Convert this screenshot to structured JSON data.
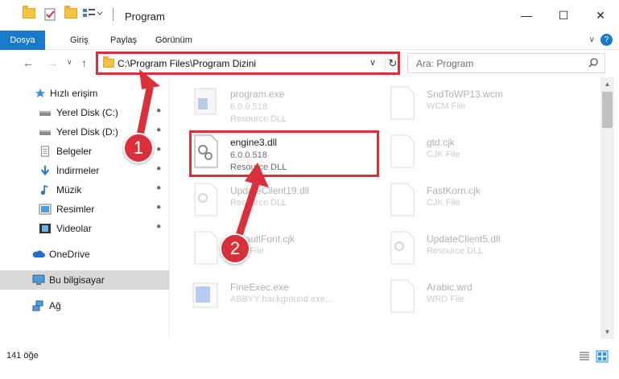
{
  "window": {
    "title": "Program",
    "minimize_icon": "minimize-icon",
    "maximize_icon": "maximize-icon",
    "close_icon": "close-icon"
  },
  "ribbon": {
    "tabs": [
      "Dosya",
      "Giriş",
      "Paylaş",
      "Görünüm"
    ],
    "help": "?"
  },
  "address": {
    "path": "C:\\Program Files\\Program Dizini",
    "search_placeholder": "Ara: Program"
  },
  "sidebar": {
    "items": [
      {
        "label": "Hızlı erişim",
        "icon": "star-icon",
        "pinned": false
      },
      {
        "label": "Yerel Disk (C:)",
        "icon": "disk-icon",
        "pinned": true
      },
      {
        "label": "Yerel Disk (D:)",
        "icon": "disk-icon",
        "pinned": true
      },
      {
        "label": "Belgeler",
        "icon": "documents-icon",
        "pinned": true
      },
      {
        "label": "İndirmeler",
        "icon": "download-icon",
        "pinned": true
      },
      {
        "label": "Müzik",
        "icon": "music-icon",
        "pinned": true
      },
      {
        "label": "Resimler",
        "icon": "pictures-icon",
        "pinned": true
      },
      {
        "label": "Videolar",
        "icon": "video-icon",
        "pinned": true
      },
      {
        "label": "OneDrive",
        "icon": "cloud-icon",
        "pinned": false
      },
      {
        "label": "Bu bilgisayar",
        "icon": "computer-icon",
        "pinned": false,
        "selected": true
      },
      {
        "label": "Ağ",
        "icon": "network-icon",
        "pinned": false
      }
    ]
  },
  "files": [
    {
      "name": "program.exe",
      "version": "6.0.0.518",
      "desc": "Resource DLL",
      "faded": true
    },
    {
      "name": "SndToWP13.wcm",
      "version": "",
      "desc": "WCM File",
      "faded": true
    },
    {
      "name": "engine3.dll",
      "version": "6.0.0.518",
      "desc": "Resource DLL",
      "faded": false
    },
    {
      "name": "gtd.cjk",
      "version": "",
      "desc": "CJK File",
      "faded": true
    },
    {
      "name": "UpdateClient19.dll",
      "version": "",
      "desc": "Resource DLL",
      "faded": true
    },
    {
      "name": "FastKorn.cjk",
      "version": "",
      "desc": "CJK File",
      "faded": true
    },
    {
      "name": "DefaultFont.cjk",
      "version": "",
      "desc": "CJK File",
      "faded": true
    },
    {
      "name": "UpdateClient5.dll",
      "version": "",
      "desc": "Resource DLL",
      "faded": true
    },
    {
      "name": "FineExec.exe",
      "version": "",
      "desc": "ABBYY background exe...",
      "faded": true
    },
    {
      "name": "Arabic.wrd",
      "version": "",
      "desc": "WRD File",
      "faded": true
    }
  ],
  "status": {
    "count": "141 öğe"
  },
  "callouts": [
    "1",
    "2"
  ],
  "colors": {
    "accent": "#1979ca",
    "highlight": "#d9303a"
  }
}
